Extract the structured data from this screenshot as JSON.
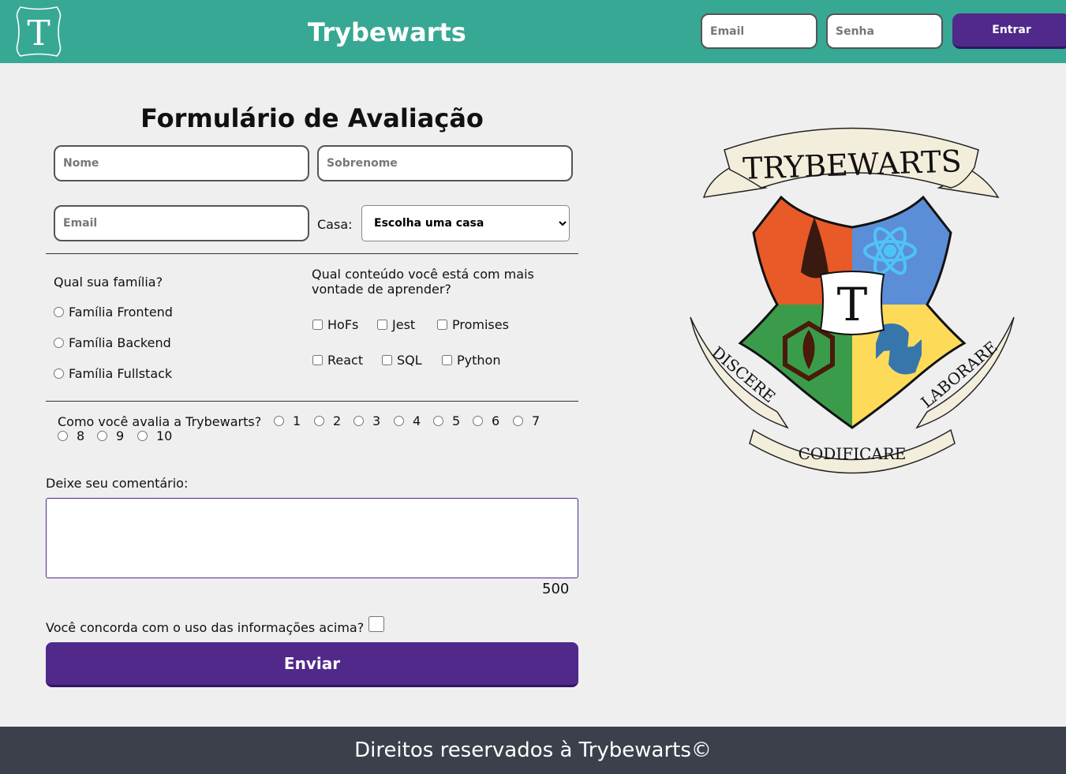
{
  "header": {
    "logo_letter": "T",
    "title": "Trybewarts",
    "login": {
      "email_placeholder": "Email",
      "password_placeholder": "Senha",
      "button_label": "Entrar"
    }
  },
  "form": {
    "title": "Formulário de Avaliação",
    "nome_placeholder": "Nome",
    "sobrenome_placeholder": "Sobrenome",
    "email_placeholder": "Email",
    "casa_label": "Casa:",
    "casa_selected": "Escolha uma casa",
    "family_question": "Qual sua família?",
    "families": [
      "Família Frontend",
      "Família Backend",
      "Família Fullstack"
    ],
    "content_question": "Qual conteúdo você está com mais vontade de aprender?",
    "contents": [
      "HoFs",
      "Jest",
      "Promises",
      "React",
      "SQL",
      "Python"
    ],
    "rate_question": "Como você avalia a Trybewarts?",
    "rates": [
      "1",
      "2",
      "3",
      "4",
      "5",
      "6",
      "7",
      "8",
      "9",
      "10"
    ],
    "comment_label": "Deixe seu comentário:",
    "counter": "500",
    "agree_label": "Você concorda com o uso das informações acima?",
    "submit_label": "Enviar"
  },
  "crest": {
    "banner_top": "TRYBEWARTS",
    "motto_left": "DISCERE",
    "motto_bottom": "CODIFICARE",
    "motto_right": "LABORARE",
    "center_letter": "T",
    "colors": {
      "red": "#e85a27",
      "blue": "#5c8ed8",
      "green": "#3a9c4a",
      "yellow": "#fddb58",
      "parchment": "#f3eedb"
    }
  },
  "footer": {
    "text": "Direitos reservados à Trybewarts©"
  }
}
